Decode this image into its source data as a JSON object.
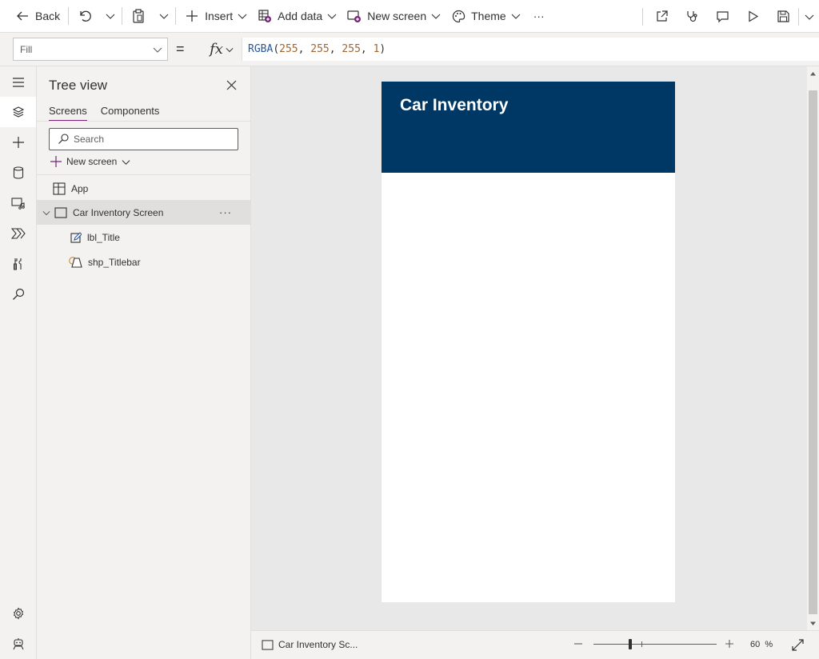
{
  "toolbar": {
    "back": "Back",
    "insert": "Insert",
    "add_data": "Add data",
    "new_screen": "New screen",
    "theme": "Theme",
    "more": "···"
  },
  "formula_bar": {
    "property": "Fill",
    "equals": "=",
    "fx": "fx",
    "formula": {
      "func": "RGBA",
      "open": "(",
      "args": [
        "255",
        "255",
        "255",
        "1"
      ],
      "sep": ", ",
      "close": ")"
    }
  },
  "tree_view": {
    "title": "Tree view",
    "tabs": [
      {
        "label": "Screens",
        "active": true
      },
      {
        "label": "Components",
        "active": false
      }
    ],
    "search_placeholder": "Search",
    "new_screen": "New screen",
    "nodes": [
      {
        "label": "App",
        "icon": "app-icon"
      },
      {
        "label": "Car Inventory Screen",
        "icon": "screen-icon",
        "selected": true,
        "more": "···"
      },
      {
        "label": "lbl_Title",
        "icon": "label-icon"
      },
      {
        "label": "shp_Titlebar",
        "icon": "shape-icon"
      }
    ]
  },
  "canvas": {
    "screen_title": "Car Inventory",
    "titlebar_color": "#003865",
    "screen_fill": "#ffffff"
  },
  "status_bar": {
    "screen_name": "Car Inventory Sc...",
    "zoom_value": "60",
    "zoom_unit": "%",
    "zoom_fraction": 0.3
  },
  "colors": {
    "accent": "#742774",
    "formula_func": "#2b579a",
    "formula_number": "#a1662f"
  }
}
